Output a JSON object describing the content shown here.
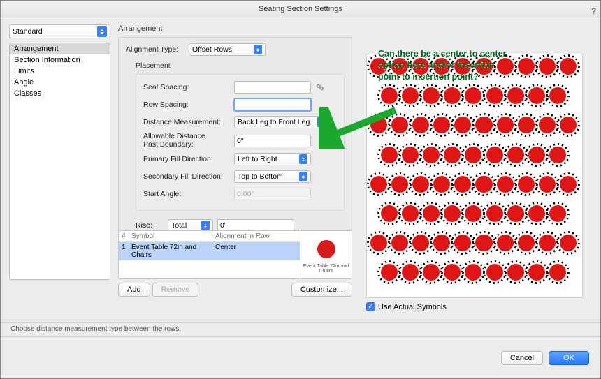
{
  "window": {
    "title": "Seating Section Settings"
  },
  "sidebar": {
    "preset": "Standard",
    "items": [
      "Arrangement",
      "Section Information",
      "Limits",
      "Angle",
      "Classes"
    ],
    "selected_index": 0
  },
  "arrangement": {
    "group_label": "Arrangement",
    "alignment_type_label": "Alignment Type:",
    "alignment_type_value": "Offset Rows",
    "placement": {
      "label": "Placement",
      "seat_spacing_label": "Seat Spacing:",
      "seat_spacing_value": "",
      "row_spacing_label": "Row Spacing:",
      "row_spacing_value": "",
      "distance_measurement_label": "Distance Measurement:",
      "distance_measurement_value": "Back Leg to Front Leg",
      "allowable_dist_label_line1": "Allowable Distance",
      "allowable_dist_label_line2": "Past Boundary:",
      "allowable_dist_value": "0\"",
      "primary_fill_label": "Primary Fill Direction:",
      "primary_fill_value": "Left to Right",
      "secondary_fill_label": "Secondary Fill Direction:",
      "secondary_fill_value": "Top to Bottom",
      "start_angle_label": "Start Angle:",
      "start_angle_value": "0.00°"
    },
    "rise_label": "Rise:",
    "rise_type": "Total",
    "rise_value": "0\""
  },
  "symbol_table": {
    "headers": {
      "num": "#",
      "symbol": "Symbol",
      "align": "Alignment in Row"
    },
    "rows": [
      {
        "num": "1",
        "symbol": "Event Table 72in and Chairs",
        "align": "Center"
      }
    ],
    "preview_caption": "Event Table 72in and Chairs"
  },
  "buttons": {
    "add": "Add",
    "remove": "Remove",
    "customize": "Customize...",
    "cancel": "Cancel",
    "ok": "OK"
  },
  "preview_panel": {
    "use_actual_symbols_label": "Use Actual Symbols",
    "use_actual_symbols_checked": true,
    "seat_layout": {
      "rows": 8,
      "cols_even": 10,
      "cols_odd": 9,
      "offset": true
    }
  },
  "annotation": {
    "line1": "Can there be a center to center",
    "line2": "option here and/or insertion",
    "line3": "point to insertion point?"
  },
  "hint": "Choose distance measurement type between the rows."
}
